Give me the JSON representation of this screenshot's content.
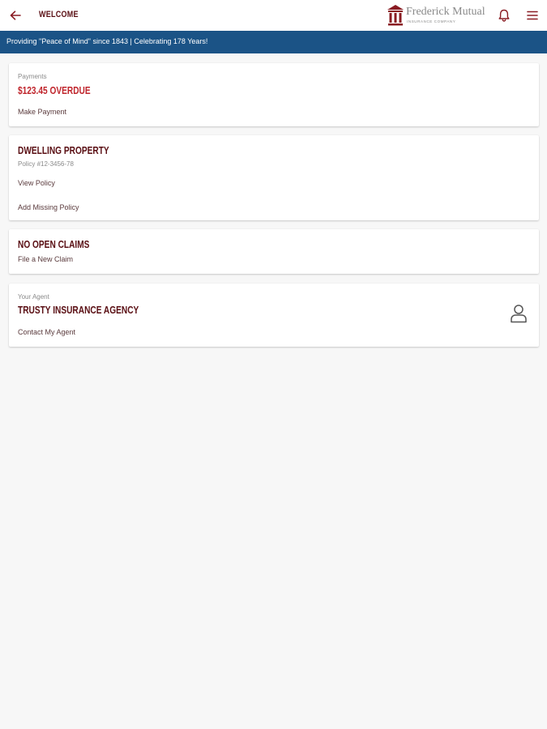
{
  "header": {
    "title": "WELCOME",
    "back_icon": "arrow-left-icon",
    "logo": {
      "name": "Frederick Mutual",
      "subtitle": "INSURANCE COMPANY",
      "brand_color": "#8a1c23"
    },
    "notification_icon": "bell-icon",
    "menu_icon": "hamburger-menu-icon"
  },
  "banner": {
    "text": "Providing \"Peace of Mind\" since 1843 | Celebrating 178 Years!",
    "background": "#1b5386"
  },
  "payments": {
    "label": "Payments",
    "amount": "$123.45 OVERDUE",
    "action": "Make Payment",
    "alert_color": "#c0262d"
  },
  "policy": {
    "title": "DWELLING PROPERTY",
    "number": "Policy #12-3456-78",
    "view_action": "View Policy",
    "add_action": "Add Missing Policy"
  },
  "claims": {
    "title": "NO OPEN CLAIMS",
    "action": "File a New Claim"
  },
  "agent": {
    "label": "Your Agent",
    "name": "TRUSTY INSURANCE AGENCY",
    "action": "Contact My Agent",
    "icon": "person-icon"
  },
  "colors": {
    "heading": "#5a0f14",
    "background": "#f7f7f7"
  }
}
